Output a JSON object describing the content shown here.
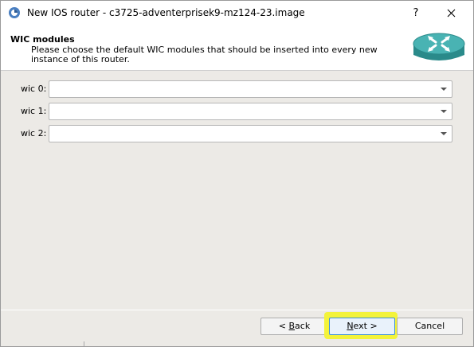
{
  "window": {
    "title": "New IOS router - c3725-adventerprisek9-mz124-23.image",
    "help_glyph": "?",
    "app_icon": "gns3-app-icon",
    "close_icon": "close-icon"
  },
  "header": {
    "title": "WIC modules",
    "subtitle": "Please choose the default WIC modules that should be inserted into every new instance of this router.",
    "image": "router-icon"
  },
  "wic_slots": [
    {
      "label": "wic 0:",
      "value": ""
    },
    {
      "label": "wic 1:",
      "value": ""
    },
    {
      "label": "wic 2:",
      "value": ""
    }
  ],
  "buttons": {
    "back_prefix": "< ",
    "back_mnemonic": "B",
    "back_rest": "ack",
    "next_mnemonic": "N",
    "next_rest": "ext >",
    "cancel": "Cancel"
  },
  "colors": {
    "dialog_background": "#eceae6",
    "highlight": "#f3f33a",
    "router_teal": "#3aa5a5"
  }
}
